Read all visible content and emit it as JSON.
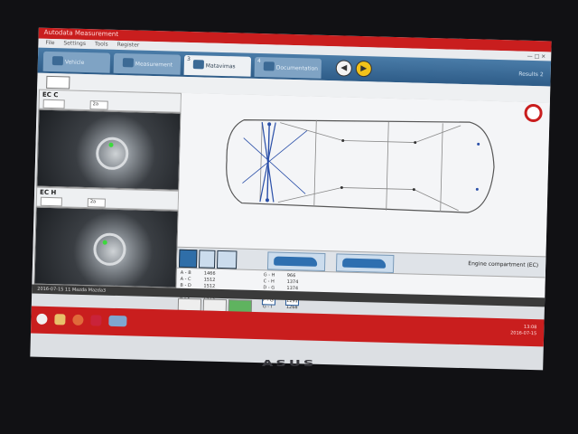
{
  "window": {
    "title": "Autodata Measurement"
  },
  "menu": {
    "items": [
      "File",
      "Settings",
      "Tools",
      "Register"
    ]
  },
  "tabs": [
    {
      "num": "",
      "label": "Vehicle"
    },
    {
      "num": "",
      "label": "Measurement"
    },
    {
      "num": "3",
      "label": "Matavimas"
    },
    {
      "num": "4",
      "label": "Documentation"
    }
  ],
  "nav": {
    "back": "◀",
    "forward": "▶"
  },
  "tabbar_right": "Results 2",
  "left": {
    "panel1": {
      "label": "EC  C",
      "sel1": "",
      "sel2": "2a"
    },
    "panel2": {
      "label": "EC  H",
      "sel1": "",
      "sel2": "2a"
    }
  },
  "view": {
    "engine_label": "Engine compartment (EC)"
  },
  "table": {
    "left_rows": [
      {
        "id": "A - B",
        "val": "1466"
      },
      {
        "id": "A - C",
        "val": "1512"
      },
      {
        "id": "B - D",
        "val": "1512"
      },
      {
        "id": "A - E",
        "val": "1523"
      },
      {
        "id": "B - F",
        "val": "1523"
      },
      {
        "id": "E - F",
        "val": "966"
      }
    ],
    "right_rows": [
      {
        "id": "G - H",
        "val": "966"
      },
      {
        "id": "C - H",
        "val": "1374"
      },
      {
        "id": "D - G",
        "val": "1374"
      },
      {
        "id": "E - H",
        "val": "1274"
      },
      {
        "id": "F - G",
        "val": "1291"
      },
      {
        "id": "G - I",
        "val": "1268"
      }
    ]
  },
  "status": {
    "text": "2016-07-15 11 Mazda Mazda3"
  },
  "tray": {
    "time": "13:08",
    "date": "2016-07-15"
  },
  "bezel_logo": "ASUS"
}
